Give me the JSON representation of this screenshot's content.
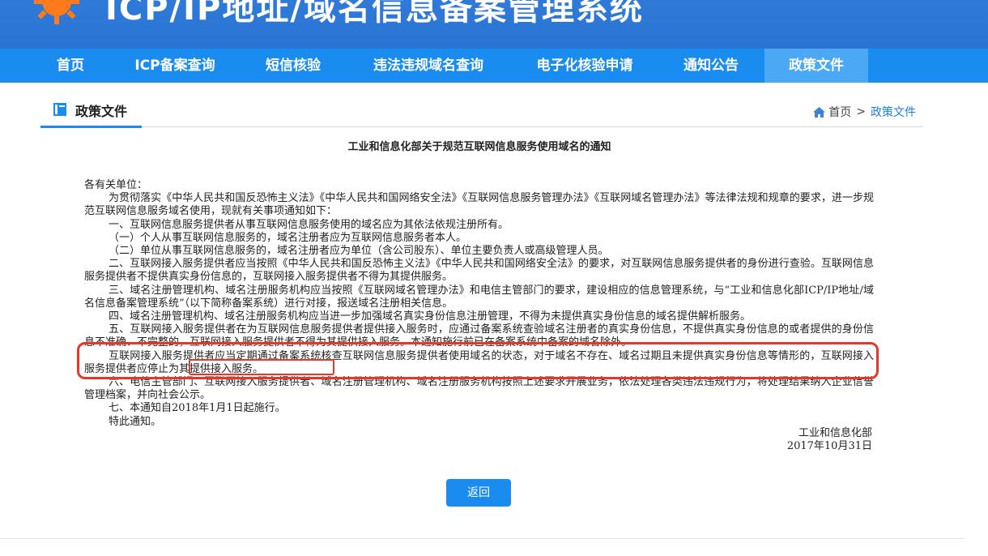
{
  "banner": {
    "title": "ICP/IP地址/域名信息备案管理系统",
    "logo_icon": "sun-logo-icon",
    "color": "#2f7ad8"
  },
  "nav": {
    "items": [
      {
        "label": "首页"
      },
      {
        "label": "ICP备案查询"
      },
      {
        "label": "短信核验"
      },
      {
        "label": "违法违规域名查询"
      },
      {
        "label": "电子化核验申请"
      },
      {
        "label": "通知公告"
      },
      {
        "label": "政策文件"
      }
    ],
    "active": "政策文件",
    "color": "#1a8cf0"
  },
  "section": {
    "title": "政策文件",
    "icon": "book-icon"
  },
  "breadcrumb": {
    "home": "首页",
    "separator": ">",
    "current": "政策文件"
  },
  "article": {
    "title": "工业和信息化部关于规范互联网信息服务使用域名的通知",
    "salutation": "各有关单位：",
    "paragraphs": [
      "为贯彻落实《中华人民共和国反恐怖主义法》《中华人民共和国网络安全法》《互联网信息服务管理办法》《互联网域名管理办法》等法律法规和规章的要求，进一步规范互联网信息服务域名使用，现就有关事项通知如下：",
      "一、互联网信息服务提供者从事互联网信息服务使用的域名应为其依法依规注册所有。",
      "（一）个人从事互联网信息服务的，域名注册者应为互联网信息服务者本人。",
      "（二）单位从事互联网信息服务的，域名注册者应为单位（含公司股东）、单位主要负责人或高级管理人员。",
      "二、互联网接入服务提供者应当按照《中华人民共和国反恐怖主义法》《中华人民共和国网络安全法》的要求，对互联网信息服务提供者的身份进行查验。互联网信息服务提供者不提供真实身份信息的，互联网接入服务提供者不得为其提供服务。",
      "三、域名注册管理机构、域名注册服务机构应当按照《互联网域名管理办法》和电信主管部门的要求，建设相应的信息管理系统，与“工业和信息化部ICP/IP地址/域名信息备案管理系统”（以下简称备案系统）进行对接，报送域名注册相关信息。",
      "四、域名注册管理机构、域名注册服务机构应当进一步加强域名真实身份信息注册管理，不得为未提供真实身份信息的域名提供解析服务。",
      "五、互联网接入服务提供者在为互联网信息服务提供者提供接入服务时，应通过备案系统查验域名注册者的真实身份信息，不提供真实身份信息的或者提供的身份信息不准确、不完整的，互联网接入服务提供者不得为其提供接入服务。本通知施行前已在备案系统中备案的域名除外。",
      "互联网接入服务提供者应当定期通过备案系统核查互联网信息服务提供者使用域名的状态，对于域名不存在、域名过期且未提供真实身份信息等情形的，互联网接入服务提供者应停止为其提供接入服务。",
      "六、电信主管部门、互联网接入服务提供者、域名注册管理机构、域名注册服务机构按照上述要求开展业务，依法处理各类违法违规行为，将处理结果纳入企业信誉管理档案，并向社会公示。",
      "七、本通知自2018年1月1日起施行。",
      "特此通知。"
    ],
    "signature": "工业和信息化部",
    "date": "2017年10月31日"
  },
  "annotation": {
    "color": "#e03a2b"
  },
  "back_button": {
    "label": "返回"
  }
}
